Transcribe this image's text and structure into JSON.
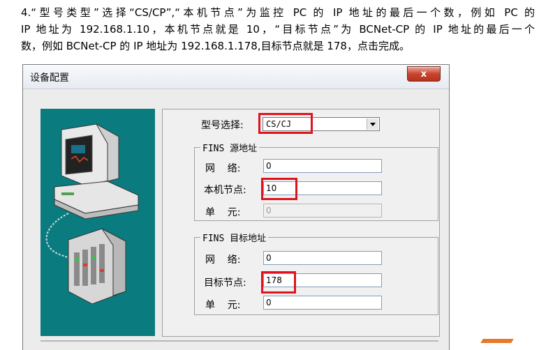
{
  "doc": {
    "line1": "4.“型号类型”选择“CS/CP”,“本机节点”为监控 PC 的 IP 地址的最后一个数，例如 PC 的",
    "line2": "IP 地址为 192.168.1.10，本机节点就是 10，“目标节点”为 BCNet-CP 的 IP 地址的最后一个",
    "line3": "数，例如 BCNet-CP 的 IP 地址为 192.168.1.178,目标节点就是 178，点击完成。"
  },
  "dialog": {
    "title": "设备配置",
    "close_label": "x",
    "model_label": "型号选择:",
    "model_value": "CS/CJ",
    "source_group": {
      "legend": "FINS 源地址",
      "network_label": "网    络:",
      "network_value": "0",
      "node_label": "本机节点:",
      "node_value": "10",
      "unit_label": "单    元:",
      "unit_value": "0"
    },
    "target_group": {
      "legend": "FINS 目标地址",
      "network_label": "网    络:",
      "network_value": "0",
      "node_label": "目标节点:",
      "node_value": "178",
      "unit_label": "单    元:",
      "unit_value": "0"
    }
  },
  "colors": {
    "illustration_bg": "#0a7c7f",
    "highlight": "#e0121c"
  },
  "icons": {
    "computer": "computer-icon",
    "plc": "plc-device-icon",
    "dropdown": "chevron-down-icon",
    "close": "close-icon"
  }
}
